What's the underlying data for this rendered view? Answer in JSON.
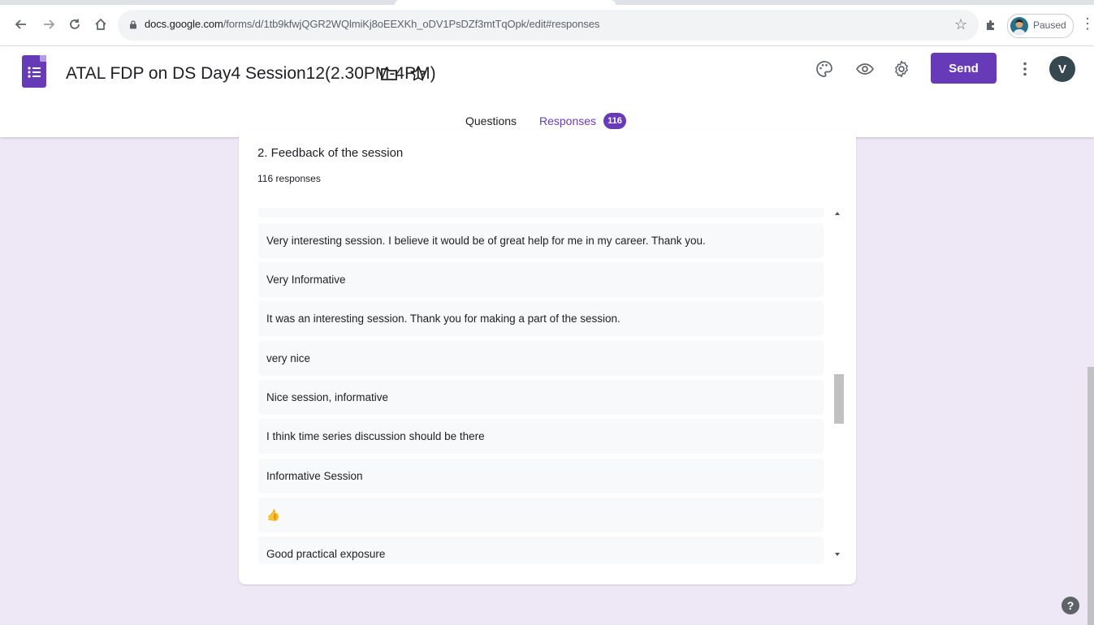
{
  "browser": {
    "url_host": "docs.google.com",
    "url_path": "/forms/d/1tb9kfwjQGR2WQlmiKj8oEEXKh_oDV1PsDZf3mtTqOpk/edit#responses",
    "profile_label": "Paused",
    "icons": {
      "back": "arrow-left-icon",
      "forward": "arrow-right-icon",
      "reload": "reload-icon",
      "home": "home-icon",
      "lock": "lock-icon",
      "bookmark": "star-outline-icon",
      "extensions": "puzzle-icon",
      "menu": "vertical-dots-icon"
    }
  },
  "header": {
    "title": "ATAL FDP on DS Day4 Session12(2.30PM-4PM)",
    "send_label": "Send",
    "avatar_letter": "V",
    "accent_color": "#673ab7"
  },
  "tabs": {
    "questions_label": "Questions",
    "responses_label": "Responses",
    "responses_count": "116"
  },
  "question": {
    "title": "2. Feedback of the session",
    "count_label": "116 responses",
    "responses": [
      "Very interesting session. I believe it would be of great help for me in my career. Thank you.",
      "Very Informative",
      "It was an interesting session. Thank you for making a part of the session.",
      "very nice",
      "Nice session, informative",
      "I think time series discussion should be there",
      "Informative Session",
      "👍",
      "Good practical exposure"
    ]
  },
  "help_label": "?"
}
